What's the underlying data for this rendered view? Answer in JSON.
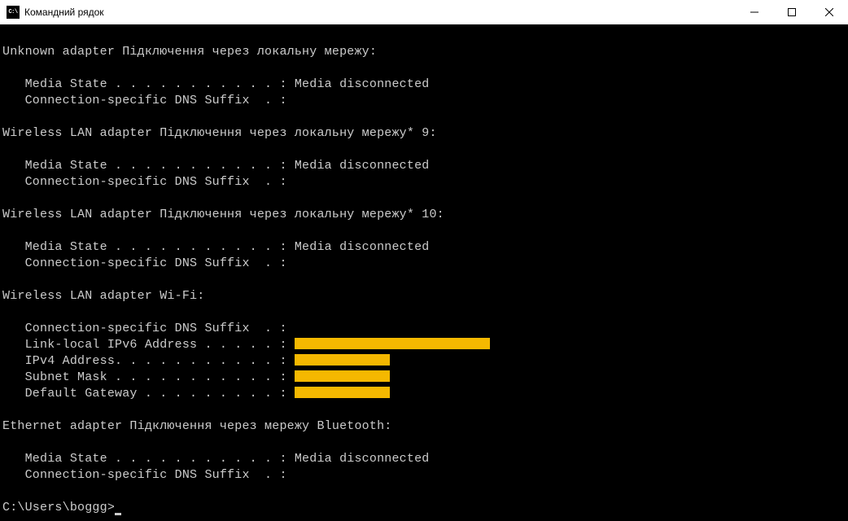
{
  "window": {
    "icon_text": "C:\\",
    "title": "Командний рядок"
  },
  "sections": [
    {
      "header": "Unknown adapter Підключення через локальну мережу:",
      "lines": [
        {
          "label": "   Media State . . . . . . . . . . . : ",
          "value": "Media disconnected"
        },
        {
          "label": "   Connection-specific DNS Suffix  . :",
          "value": ""
        }
      ]
    },
    {
      "header": "Wireless LAN adapter Підключення через локальну мережу* 9:",
      "lines": [
        {
          "label": "   Media State . . . . . . . . . . . : ",
          "value": "Media disconnected"
        },
        {
          "label": "   Connection-specific DNS Suffix  . :",
          "value": ""
        }
      ]
    },
    {
      "header": "Wireless LAN adapter Підключення через локальну мережу* 10:",
      "lines": [
        {
          "label": "   Media State . . . . . . . . . . . : ",
          "value": "Media disconnected"
        },
        {
          "label": "   Connection-specific DNS Suffix  . :",
          "value": ""
        }
      ]
    },
    {
      "header": "Wireless LAN adapter Wi-Fi:",
      "lines": [
        {
          "label": "   Connection-specific DNS Suffix  . :",
          "value": ""
        },
        {
          "label": "   Link-local IPv6 Address . . . . . : ",
          "redacted": "w1"
        },
        {
          "label": "   IPv4 Address. . . . . . . . . . . : ",
          "redacted": "w2"
        },
        {
          "label": "   Subnet Mask . . . . . . . . . . . : ",
          "redacted": "w2"
        },
        {
          "label": "   Default Gateway . . . . . . . . . : ",
          "redacted": "w2"
        }
      ]
    },
    {
      "header": "Ethernet adapter Підключення через мережу Bluetooth:",
      "lines": [
        {
          "label": "   Media State . . . . . . . . . . . : ",
          "value": "Media disconnected"
        },
        {
          "label": "   Connection-specific DNS Suffix  . :",
          "value": ""
        }
      ]
    }
  ],
  "prompt": "C:\\Users\\boggg>"
}
